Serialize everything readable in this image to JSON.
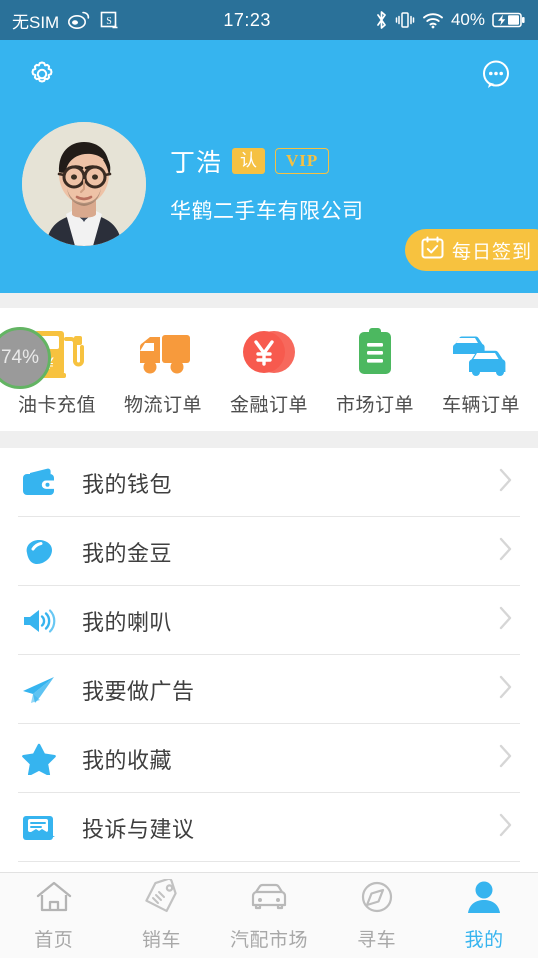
{
  "statusbar": {
    "carrier": "无SIM",
    "time": "17:23",
    "battery_percent": "40%",
    "icons": [
      "weibo-icon",
      "screenshot-icon",
      "bluetooth-icon",
      "vibrate-icon",
      "wifi-icon",
      "battery-charging-icon"
    ]
  },
  "header": {
    "settings_icon": "gear-icon",
    "message_icon": "chat-bubble-icon",
    "avatar_name": "avatar",
    "user_name": "丁浩",
    "badge_verified": "认",
    "badge_vip": "VIP",
    "company": "华鹤二手车有限公司",
    "signin_label": "每日签到",
    "signin_icon": "calendar-check-icon",
    "bg_color": "#36b4ef"
  },
  "quick_actions": [
    {
      "label": "油卡充值",
      "icon": "fuel-card-icon",
      "color": "#f7c23f",
      "overlay": "74%"
    },
    {
      "label": "物流订单",
      "icon": "truck-icon",
      "color": "#f79a3c"
    },
    {
      "label": "金融订单",
      "icon": "yen-coin-icon",
      "color": "#f75a4e"
    },
    {
      "label": "市场订单",
      "icon": "clipboard-icon",
      "color": "#4cb860"
    },
    {
      "label": "车辆订单",
      "icon": "cars-icon",
      "color": "#36b4ef"
    }
  ],
  "list_items": [
    {
      "label": "我的钱包",
      "icon": "wallet-icon"
    },
    {
      "label": "我的金豆",
      "icon": "bean-icon"
    },
    {
      "label": "我的喇叭",
      "icon": "speaker-icon"
    },
    {
      "label": "我要做广告",
      "icon": "paper-plane-icon"
    },
    {
      "label": "我的收藏",
      "icon": "star-icon"
    },
    {
      "label": "投诉与建议",
      "icon": "mail-icon"
    }
  ],
  "tabbar": [
    {
      "label": "首页",
      "icon": "home-icon",
      "active": false
    },
    {
      "label": "销车",
      "icon": "price-tags-icon",
      "active": false
    },
    {
      "label": "汽配市场",
      "icon": "car-icon",
      "active": false
    },
    {
      "label": "寻车",
      "icon": "compass-icon",
      "active": false
    },
    {
      "label": "我的",
      "icon": "person-icon",
      "active": true
    }
  ],
  "colors": {
    "accent": "#36b4ef",
    "statusbar": "#2a7199",
    "gold": "#f7c23f",
    "inactive": "#a8a8a8"
  }
}
